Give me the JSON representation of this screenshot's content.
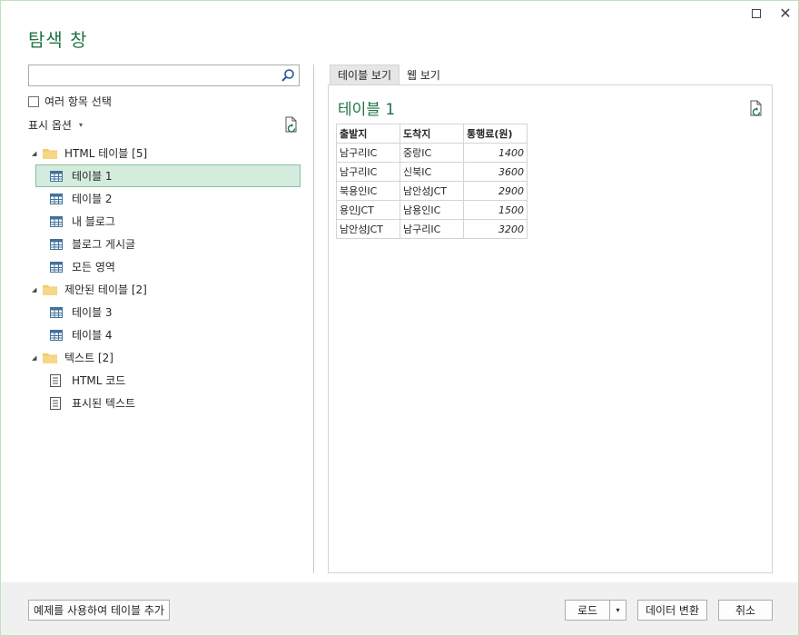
{
  "window": {
    "title": "탐색 창",
    "maximize_icon": "maximize-icon",
    "close_icon": "close-icon"
  },
  "search": {
    "value": "",
    "placeholder": "",
    "icon": "search-icon"
  },
  "multi_select": {
    "label": "여러 항목 선택",
    "checked": false
  },
  "display_options": {
    "label": "표시 옵션",
    "caret": "▾"
  },
  "tree": {
    "groups": [
      {
        "label": "HTML 테이블 [5]",
        "items": [
          "테이블 1",
          "테이블 2",
          "내 블로그",
          "블로그 게시글",
          "모든 영역"
        ]
      },
      {
        "label": "제안된 테이블 [2]",
        "items": [
          "테이블 3",
          "테이블 4"
        ]
      },
      {
        "label": "텍스트 [2]",
        "items": [
          "HTML 코드",
          "표시된 텍스트"
        ]
      }
    ],
    "selected": "테이블 1"
  },
  "tabs": [
    {
      "label": "테이블 보기",
      "active": true
    },
    {
      "label": "웹 보기",
      "active": false
    }
  ],
  "preview": {
    "title": "테이블 1",
    "columns": [
      "출발지",
      "도착지",
      "통행료(원)"
    ],
    "rows": [
      [
        "남구리IC",
        "중랑IC",
        "1400"
      ],
      [
        "남구리IC",
        "신북IC",
        "3600"
      ],
      [
        "북용인IC",
        "남안성JCT",
        "2900"
      ],
      [
        "용인JCT",
        "남용인IC",
        "1500"
      ],
      [
        "남안성JCT",
        "남구리IC",
        "3200"
      ]
    ]
  },
  "footer": {
    "example_button": "예제를 사용하여 테이블 추가",
    "load_button": "로드",
    "load_dropdown": "▾",
    "transform_button": "데이터 변환",
    "cancel_button": "취소"
  },
  "colors": {
    "accent": "#217346",
    "selected_bg": "#d4ecdd",
    "footer_bg": "#f0f0f0"
  }
}
